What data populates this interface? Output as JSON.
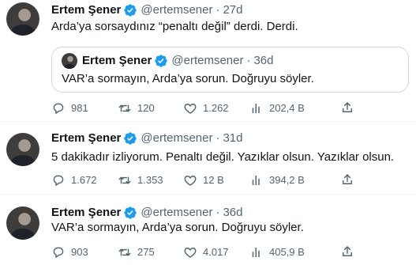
{
  "tweets": [
    {
      "name": "Ertem Şener",
      "handle": "@ertemsener",
      "separator": "·",
      "time": "27d",
      "text": "Arda’ya sorsaydınız “penaltı değil” derdi. Derdi.",
      "quote": {
        "name": "Ertem Şener",
        "handle": "@ertemsener",
        "separator": "·",
        "time": "36d",
        "text": "VAR’a sormayın, Arda’ya sorun. Doğruyu söyler."
      },
      "replies": "981",
      "retweets": "120",
      "likes": "1.262",
      "views": "202,4 B"
    },
    {
      "name": "Ertem Şener",
      "handle": "@ertemsener",
      "separator": "·",
      "time": "31d",
      "text": "5 dakikadır izliyorum. Penaltı değil. Yazıklar olsun. Yazıklar olsun.",
      "replies": "1.672",
      "retweets": "1.353",
      "likes": "12 B",
      "views": "394,2 B"
    },
    {
      "name": "Ertem Şener",
      "handle": "@ertemsener",
      "separator": "·",
      "time": "36d",
      "text": "VAR’a sormayın, Arda’ya sorun. Doğruyu söyler.",
      "replies": "903",
      "retweets": "275",
      "likes": "4.017",
      "views": "405,9 B"
    }
  ],
  "colors": {
    "verified_badge": "#1d9bf0",
    "secondary_text": "#536471",
    "divider": "#eff3f4",
    "quote_border": "#cfd9de"
  },
  "icons": [
    "verified-badge-icon",
    "reply-icon",
    "retweet-icon",
    "like-icon",
    "views-icon",
    "share-icon"
  ]
}
